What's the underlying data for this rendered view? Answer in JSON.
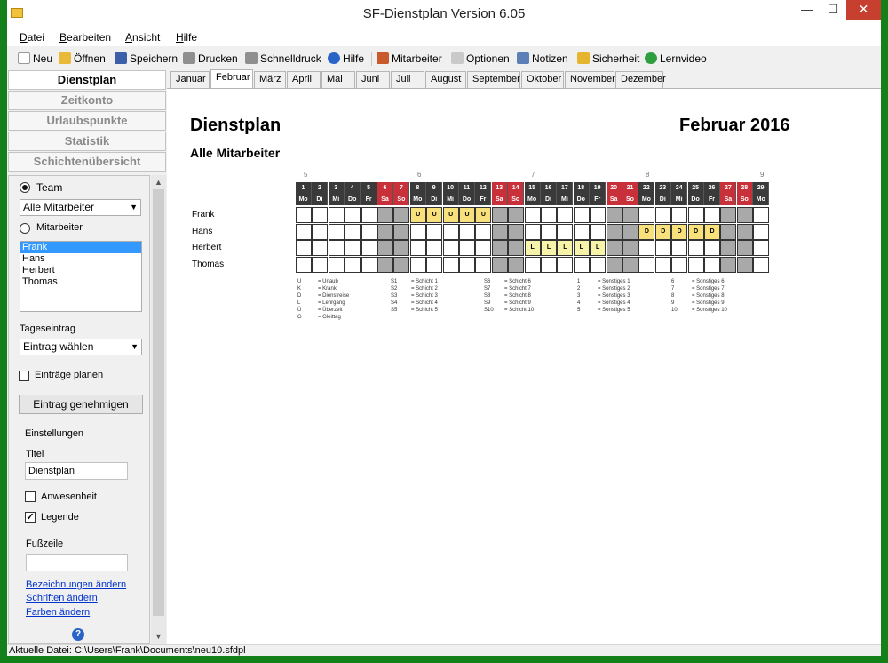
{
  "window": {
    "title": "SF-Dienstplan Version 6.05",
    "minimize": "—",
    "maximize": "☐",
    "close": "✕"
  },
  "menu": [
    "Datei",
    "Bearbeiten",
    "Ansicht",
    "Hilfe"
  ],
  "toolbar": [
    {
      "label": "Neu",
      "icon": "new-icon",
      "color": "#ffffff"
    },
    {
      "label": "Öffnen",
      "icon": "open-folder-icon",
      "color": "#e9b93a"
    },
    {
      "label": "Speichern",
      "icon": "save-icon",
      "color": "#3b5fa8"
    },
    {
      "label": "Drucken",
      "icon": "print-icon",
      "color": "#8f8f8f"
    },
    {
      "label": "Schnelldruck",
      "icon": "quick-print-icon",
      "color": "#8f8f8f"
    },
    {
      "label": "Hilfe",
      "icon": "help-icon",
      "color": "#2a63c7"
    },
    {
      "label": "Mitarbeiter",
      "icon": "employees-icon",
      "color": "#c95a2c"
    },
    {
      "label": "Optionen",
      "icon": "options-icon",
      "color": "#c9c9c9"
    },
    {
      "label": "Notizen",
      "icon": "notes-icon",
      "color": "#5c7fb8"
    },
    {
      "label": "Sicherheit",
      "icon": "lock-icon",
      "color": "#e5b530"
    },
    {
      "label": "Lernvideo",
      "icon": "play-icon",
      "color": "#2e9e3e"
    }
  ],
  "nav": [
    "Dienstplan",
    "Zeitkonto",
    "Urlaubspunkte",
    "Statistik",
    "Schichtenübersicht"
  ],
  "panel": {
    "team_label": "Team",
    "team_select": "Alle Mitarbeiter",
    "mitarbeiter_label": "Mitarbeiter",
    "employees": [
      "Frank",
      "Hans",
      "Herbert",
      "Thomas"
    ],
    "selected_employee": "Frank",
    "tageseintrag_label": "Tageseintrag",
    "tageseintrag_select": "Eintrag wählen",
    "eintraege_planen": "Einträge planen",
    "eintrag_genehmigen": "Eintrag genehmigen",
    "einstellungen": "Einstellungen",
    "titel_label": "Titel",
    "titel_value": "Dienstplan",
    "anwesenheit": "Anwesenheit",
    "legende": "Legende",
    "fusszeile_label": "Fußzeile",
    "fusszeile_value": "",
    "links": [
      "Bezeichnungen ändern",
      "Schriften ändern",
      "Farben ändern"
    ],
    "help_glyph": "?"
  },
  "tabs": [
    "Januar",
    "Februar",
    "März",
    "April",
    "Mai",
    "Juni",
    "Juli",
    "August",
    "September",
    "Oktober",
    "November",
    "Dezember"
  ],
  "active_tab": "Februar",
  "report": {
    "title": "Dienstplan",
    "month": "Februar 2016",
    "subtitle": "Alle Mitarbeiter",
    "week_numbers": [
      "5",
      "6",
      "7",
      "8",
      "9"
    ],
    "days": [
      "1",
      "2",
      "3",
      "4",
      "5",
      "6",
      "7",
      "8",
      "9",
      "10",
      "11",
      "12",
      "13",
      "14",
      "15",
      "16",
      "17",
      "18",
      "19",
      "20",
      "21",
      "22",
      "23",
      "24",
      "25",
      "26",
      "27",
      "28",
      "29"
    ],
    "weekdays": [
      "Mo",
      "Di",
      "Mi",
      "Do",
      "Fr",
      "Sa",
      "So",
      "Mo",
      "Di",
      "Mi",
      "Do",
      "Fr",
      "Sa",
      "So",
      "Mo",
      "Di",
      "Mi",
      "Do",
      "Fr",
      "Sa",
      "So",
      "Mo",
      "Di",
      "Mi",
      "Do",
      "Fr",
      "Sa",
      "So",
      "Mo"
    ],
    "employees": [
      "Frank",
      "Hans",
      "Herbert",
      "Thomas"
    ],
    "entries": [
      {
        "employee": "Frank",
        "code": "U",
        "days": [
          8,
          9,
          10,
          11,
          12
        ]
      },
      {
        "employee": "Hans",
        "code": "D",
        "days": [
          22,
          23,
          24,
          25,
          26
        ]
      },
      {
        "employee": "Herbert",
        "code": "L",
        "days": [
          15,
          16,
          17,
          18,
          19
        ]
      }
    ],
    "colors": {
      "header": "#3a3a3a",
      "weekend_header": "#c8303a",
      "weekend_cell": "#a9a9a9",
      "urlaub": "#f8e17a",
      "lehrgang": "#f7f3a8"
    },
    "legend": [
      [
        [
          "U",
          "= Urlaub"
        ],
        [
          "K",
          "= Krank"
        ],
        [
          "D",
          "= Dienstreise"
        ],
        [
          "L",
          "= Lehrgang"
        ],
        [
          "Ü",
          "= Überzeit"
        ],
        [
          "G",
          "= Gleittag"
        ]
      ],
      [
        [
          "S1",
          "= Schicht 1"
        ],
        [
          "S2",
          "= Schicht 2"
        ],
        [
          "S3",
          "= Schicht 3"
        ],
        [
          "S4",
          "= Schicht 4"
        ],
        [
          "S5",
          "= Schicht 5"
        ]
      ],
      [
        [
          "S6",
          "= Schicht 6"
        ],
        [
          "S7",
          "= Schicht 7"
        ],
        [
          "S8",
          "= Schicht 8"
        ],
        [
          "S9",
          "= Schicht 9"
        ],
        [
          "S10",
          "= Schicht 10"
        ]
      ],
      [
        [
          "1",
          "= Sonstiges 1"
        ],
        [
          "2",
          "= Sonstiges 2"
        ],
        [
          "3",
          "= Sonstiges 3"
        ],
        [
          "4",
          "= Sonstiges 4"
        ],
        [
          "5",
          "= Sonstiges 5"
        ]
      ],
      [
        [
          "6",
          "= Sonstiges 6"
        ],
        [
          "7",
          "= Sonstiges 7"
        ],
        [
          "8",
          "= Sonstiges 8"
        ],
        [
          "9",
          "= Sonstiges 9"
        ],
        [
          "10",
          "= Sonstiges 10"
        ]
      ]
    ]
  },
  "status": "Aktuelle Datei: C:\\Users\\Frank\\Documents\\neu10.sfdpl"
}
